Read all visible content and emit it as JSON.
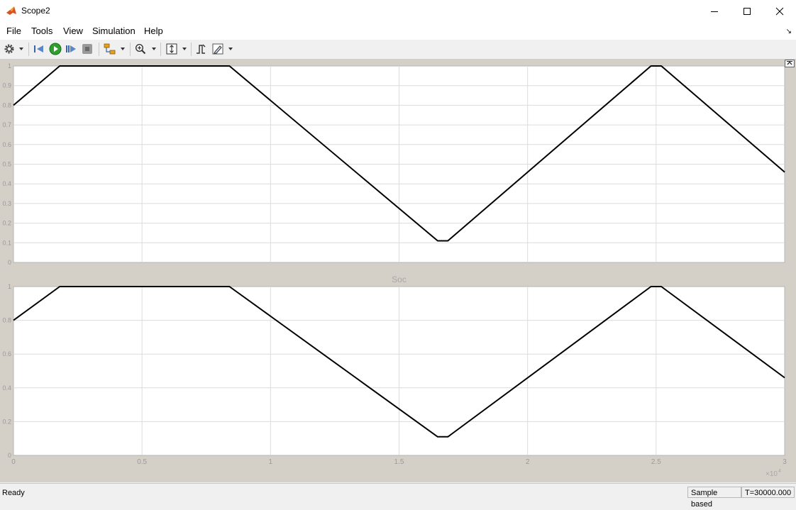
{
  "window": {
    "title": "Scope2"
  },
  "menu": {
    "items": [
      "File",
      "Tools",
      "View",
      "Simulation",
      "Help"
    ]
  },
  "status": {
    "ready": "Ready",
    "mode": "Sample based",
    "time": "T=30000.000"
  },
  "axes2": {
    "title": "Soc"
  },
  "x_exponent": {
    "base": "×10",
    "power": "4"
  },
  "chart_data": [
    {
      "type": "line",
      "x_ticks": [
        "0",
        "0.5",
        "1",
        "1.5",
        "2",
        "2.5",
        "3"
      ],
      "y_ticks": [
        "0",
        "0.1",
        "0.2",
        "0.3",
        "0.4",
        "0.5",
        "0.6",
        "0.7",
        "0.8",
        "0.9",
        "1"
      ],
      "xlim": [
        0,
        30000
      ],
      "ylim": [
        0,
        1
      ],
      "grid": true,
      "line_color": "#000000",
      "x": [
        0,
        1800,
        8400,
        16500,
        16900,
        24800,
        25200,
        30000
      ],
      "y": [
        0.8,
        1.0,
        1.0,
        0.11,
        0.11,
        1.0,
        1.0,
        0.46
      ]
    },
    {
      "type": "line",
      "title": "Soc",
      "x_ticks": [
        "0",
        "0.5",
        "1",
        "1.5",
        "2",
        "2.5",
        "3"
      ],
      "y_ticks": [
        "0",
        "0.2",
        "0.4",
        "0.6",
        "0.8",
        "1"
      ],
      "xlim": [
        0,
        30000
      ],
      "ylim": [
        0,
        1
      ],
      "grid": true,
      "line_color": "#000000",
      "x": [
        0,
        1800,
        8400,
        16500,
        16900,
        24800,
        25200,
        30000
      ],
      "y": [
        0.8,
        1.0,
        1.0,
        0.11,
        0.11,
        1.0,
        1.0,
        0.46
      ]
    }
  ]
}
